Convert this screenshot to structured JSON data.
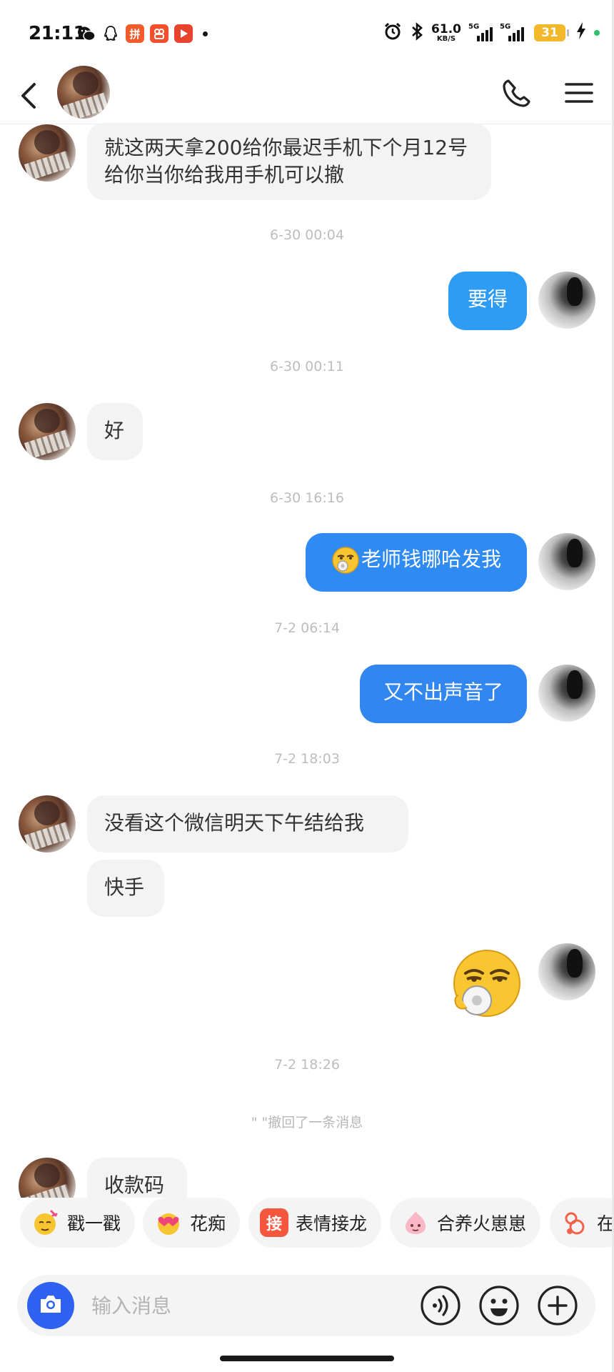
{
  "status_bar": {
    "time": "21:11",
    "net_speed_value": "61.0",
    "net_speed_unit": "KB/S",
    "sim1_tag": "5G",
    "sim2_tag": "5G",
    "battery": "31",
    "app_icons": [
      "wechat-icon",
      "qq-icon",
      "pinduoduo-icon",
      "kuaishou-icon",
      "video-play-icon"
    ],
    "status_icons": [
      "alarm-icon",
      "bluetooth-icon",
      "signal-icon",
      "battery-icon",
      "charging-icon"
    ]
  },
  "header": {
    "icons": [
      "back-arrow-icon",
      "phone-icon",
      "menu-icon"
    ]
  },
  "messages": [
    {
      "type": "in",
      "text": "就这两天拿200给你最迟手机下个月12号给你当你给我用手机可以撤"
    },
    {
      "type": "time",
      "text": "6-30 00:04"
    },
    {
      "type": "out",
      "text": "要得"
    },
    {
      "type": "time",
      "text": "6-30 00:11"
    },
    {
      "type": "in",
      "text": "好"
    },
    {
      "type": "time",
      "text": "6-30 16:16"
    },
    {
      "type": "out",
      "text": "老师钱哪哈发我",
      "emoji": "smug-face-emoji"
    },
    {
      "type": "time",
      "text": "7-2 06:14"
    },
    {
      "type": "out",
      "text": "又不出声音了"
    },
    {
      "type": "time",
      "text": "7-2 18:03"
    },
    {
      "type": "in",
      "text": "没看这个微信明天下午结给我"
    },
    {
      "type": "in",
      "text": "快手"
    },
    {
      "type": "sticker",
      "name": "smug-face-sticker"
    },
    {
      "type": "time",
      "text": "7-2 18:26"
    },
    {
      "type": "recall",
      "text": "\"               \"撤回了一条消息"
    },
    {
      "type": "in",
      "text": "收款码"
    }
  ],
  "quick_actions": [
    {
      "label": "戳一戳",
      "icon": "poke-icon"
    },
    {
      "label": "花痴",
      "icon": "heart-eyes-icon"
    },
    {
      "label": "表情接龙",
      "icon": "emoji-chain-icon",
      "icon_char": "接"
    },
    {
      "label": "合养火崽崽",
      "icon": "fire-pet-icon"
    },
    {
      "label": "在",
      "icon": "gift-icon"
    }
  ],
  "input": {
    "placeholder": "输入消息",
    "icons": [
      "camera-icon",
      "voice-icon",
      "emoji-icon",
      "plus-icon"
    ]
  },
  "colors": {
    "bubble_in": "#f3f3f3",
    "bubble_out": "#2e9cf3",
    "camera_button": "#2f62f0",
    "battery": "#f3b72a"
  }
}
